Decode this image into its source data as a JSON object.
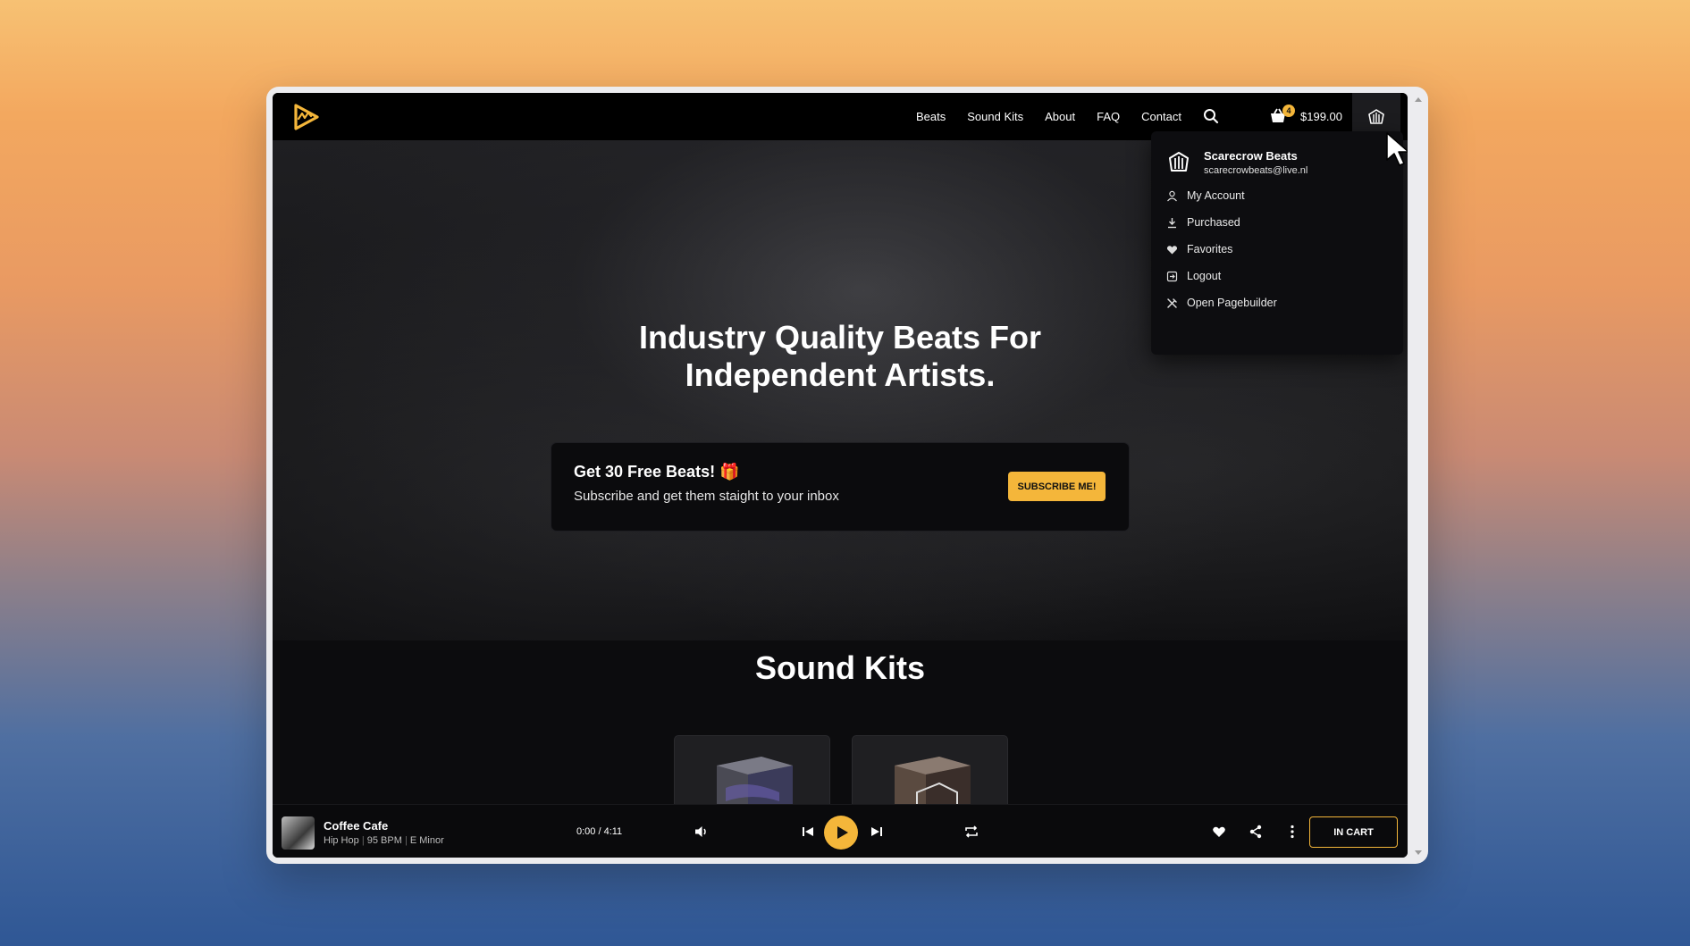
{
  "nav": {
    "links": [
      "Beats",
      "Sound Kits",
      "About",
      "FAQ",
      "Contact"
    ],
    "cart_count": "4",
    "cart_total": "$199.00"
  },
  "hero": {
    "title_line1": "Industry Quality Beats For",
    "title_line2": "Independent Artists.",
    "promo_title": "Get 30 Free Beats! 🎁",
    "promo_subtitle": "Subscribe and get them staight to your inbox",
    "subscribe_label": "SUBSCRIBE ME!"
  },
  "sound_kits": {
    "title": "Sound Kits"
  },
  "account_menu": {
    "name": "Scarecrow Beats",
    "email": "scarecrowbeats@live.nl",
    "items": [
      "My Account",
      "Purchased",
      "Favorites",
      "Logout",
      "Open Pagebuilder"
    ]
  },
  "player": {
    "track_title": "Coffee Cafe",
    "genre": "Hip Hop",
    "bpm": "95 BPM",
    "key": "E Minor",
    "time": "0:00 / 4:11",
    "cart_button": "IN CART"
  },
  "colors": {
    "accent": "#f4b63a",
    "background": "#0c0c0e"
  }
}
